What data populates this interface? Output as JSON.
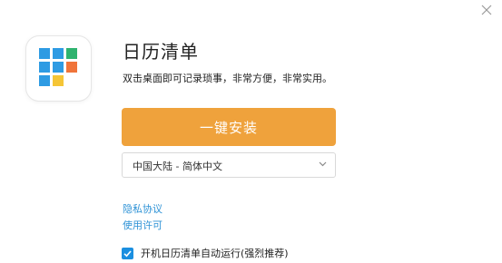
{
  "window": {
    "close_icon": "close-icon"
  },
  "app": {
    "title": "日历清单",
    "description": "双击桌面即可记录琐事，非常方便，非常实用。",
    "icon": "calendar-grid-icon",
    "icon_colors": {
      "blue": "#2e9be3",
      "green": "#2fb36f",
      "orange": "#f0743a",
      "yellow": "#f5c536"
    }
  },
  "install": {
    "label": "一键安装",
    "color": "#efa23c"
  },
  "language": {
    "selected": "中国大陆 - 简体中文",
    "icon": "chevron-down-icon"
  },
  "links": {
    "privacy": "隐私协议",
    "license": "使用许可",
    "color": "#2f93d6"
  },
  "autorun": {
    "checked": true,
    "label": "开机日历清单自动运行(强烈推荐)",
    "checkbox_color": "#1b8fe0"
  }
}
